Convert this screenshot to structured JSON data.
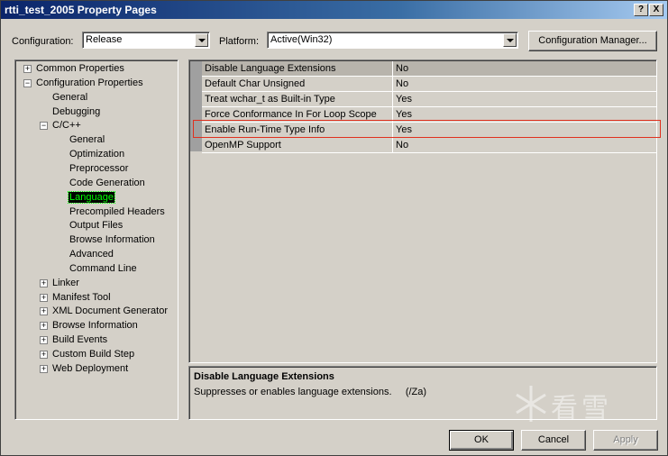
{
  "window": {
    "title": "rtti_test_2005 Property Pages",
    "help_button": "?",
    "close_button": "X"
  },
  "config": {
    "label": "Configuration:",
    "value": "Release"
  },
  "platform": {
    "label": "Platform:",
    "value": "Active(Win32)"
  },
  "config_manager_label": "Configuration Manager...",
  "tree": {
    "common_properties": "Common Properties",
    "configuration_properties": "Configuration Properties",
    "general": "General",
    "debugging": "Debugging",
    "cpp": "C/C++",
    "cpp_children": [
      "General",
      "Optimization",
      "Preprocessor",
      "Code Generation",
      "Language",
      "Precompiled Headers",
      "Output Files",
      "Browse Information",
      "Advanced",
      "Command Line"
    ],
    "others": [
      "Linker",
      "Manifest Tool",
      "XML Document Generator",
      "Browse Information",
      "Build Events",
      "Custom Build Step",
      "Web Deployment"
    ],
    "expand_plus": "+",
    "expand_minus": "−"
  },
  "grid": {
    "rows": [
      {
        "name": "Disable Language Extensions",
        "value": "No"
      },
      {
        "name": "Default Char Unsigned",
        "value": "No"
      },
      {
        "name": "Treat wchar_t as Built-in Type",
        "value": "Yes"
      },
      {
        "name": "Force Conformance In For Loop Scope",
        "value": "Yes"
      },
      {
        "name": "Enable Run-Time Type Info",
        "value": "Yes"
      },
      {
        "name": "OpenMP Support",
        "value": "No"
      }
    ]
  },
  "description": {
    "title": "Disable Language Extensions",
    "text": "Suppresses or enables language extensions.     (/Za)"
  },
  "buttons": {
    "ok": "OK",
    "cancel": "Cancel",
    "apply": "Apply"
  },
  "watermark": {
    "text": "看雪",
    "icon": "snowflake-icon"
  },
  "colors": {
    "highlight_border": "#e0301e",
    "selected_text": "#00ff00",
    "titlebar": "#0a246a"
  }
}
